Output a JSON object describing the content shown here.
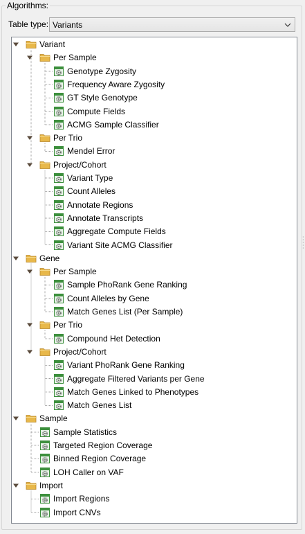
{
  "panel": {
    "title": "Algorithms:",
    "table_type_label": "Table type:",
    "table_type_value": "Variants"
  },
  "icons": {
    "expanded": "triangle-down-icon",
    "folder": "folder-icon",
    "algorithm": "gear-table-icon"
  },
  "colors": {
    "folder": "#e8b84a",
    "algorithm_icon": "#3c8f3c",
    "expander": "#5a4b3c"
  },
  "tree": [
    {
      "label": "Variant",
      "children": [
        {
          "label": "Per Sample",
          "children": [
            {
              "label": "Genotype Zygosity"
            },
            {
              "label": "Frequency Aware Zygosity"
            },
            {
              "label": "GT Style Genotype"
            },
            {
              "label": "Compute Fields"
            },
            {
              "label": "ACMG Sample Classifier"
            }
          ]
        },
        {
          "label": "Per Trio",
          "children": [
            {
              "label": "Mendel Error"
            }
          ]
        },
        {
          "label": "Project/Cohort",
          "children": [
            {
              "label": "Variant Type"
            },
            {
              "label": "Count Alleles"
            },
            {
              "label": "Annotate Regions"
            },
            {
              "label": "Annotate Transcripts"
            },
            {
              "label": "Aggregate Compute Fields"
            },
            {
              "label": "Variant Site ACMG Classifier"
            }
          ]
        }
      ]
    },
    {
      "label": "Gene",
      "children": [
        {
          "label": "Per Sample",
          "children": [
            {
              "label": "Sample PhoRank Gene Ranking"
            },
            {
              "label": "Count Alleles by Gene"
            },
            {
              "label": "Match Genes List (Per Sample)"
            }
          ]
        },
        {
          "label": "Per Trio",
          "children": [
            {
              "label": "Compound Het Detection"
            }
          ]
        },
        {
          "label": "Project/Cohort",
          "children": [
            {
              "label": "Variant PhoRank Gene Ranking"
            },
            {
              "label": "Aggregate Filtered Variants per Gene"
            },
            {
              "label": "Match Genes Linked to Phenotypes"
            },
            {
              "label": "Match Genes List"
            }
          ]
        }
      ]
    },
    {
      "label": "Sample",
      "children": [
        {
          "label": "Sample Statistics"
        },
        {
          "label": "Targeted Region Coverage"
        },
        {
          "label": "Binned Region Coverage"
        },
        {
          "label": "LOH Caller on VAF"
        }
      ]
    },
    {
      "label": "Import",
      "children": [
        {
          "label": "Import Regions"
        },
        {
          "label": "Import CNVs"
        }
      ]
    }
  ]
}
